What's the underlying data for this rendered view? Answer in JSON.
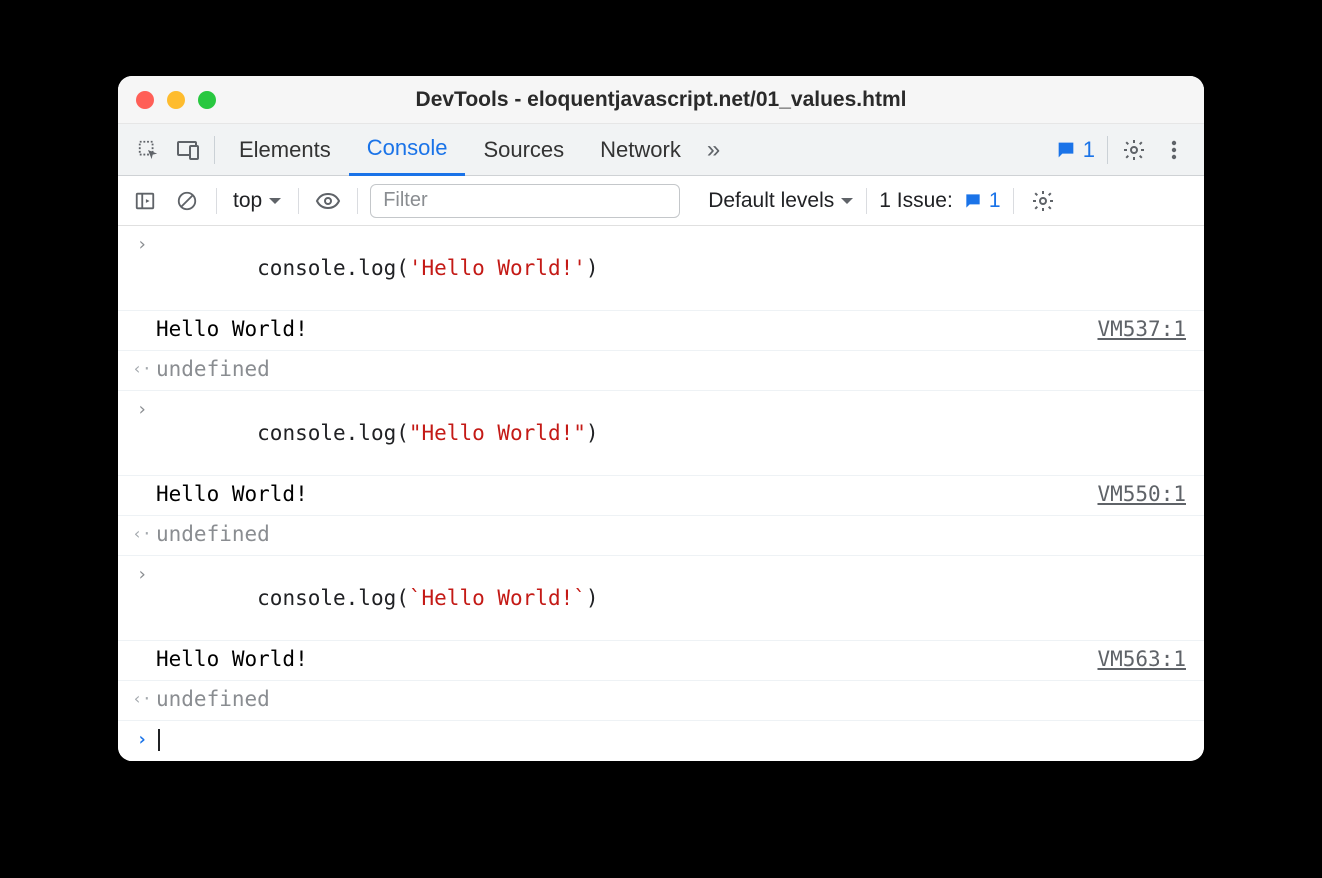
{
  "window": {
    "title": "DevTools - eloquentjavascript.net/01_values.html"
  },
  "tabs": {
    "items": [
      "Elements",
      "Console",
      "Sources",
      "Network"
    ],
    "active": "Console",
    "overflow_glyph": "»",
    "message_count": "1"
  },
  "toolbar": {
    "context_label": "top",
    "filter_placeholder": "Filter",
    "levels_label": "Default levels",
    "issues_label": "1 Issue:",
    "issues_count": "1"
  },
  "console": {
    "entries": [
      {
        "input_prefix": "console.log(",
        "input_string": "'Hello World!'",
        "input_suffix": ")",
        "output": "Hello World!",
        "source": "VM537:1",
        "return": "undefined"
      },
      {
        "input_prefix": "console.log(",
        "input_string": "\"Hello World!\"",
        "input_suffix": ")",
        "output": "Hello World!",
        "source": "VM550:1",
        "return": "undefined"
      },
      {
        "input_prefix": "console.log(",
        "input_string": "`Hello World!`",
        "input_suffix": ")",
        "output": "Hello World!",
        "source": "VM563:1",
        "return": "undefined"
      }
    ]
  }
}
